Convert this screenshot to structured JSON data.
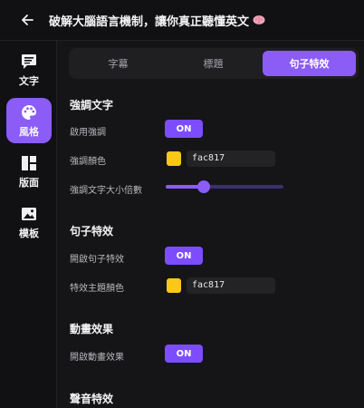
{
  "header": {
    "title": "破解大腦語言機制，讓你真正聽懂英文",
    "back_icon": "arrow-left-icon",
    "emoji_icon": "brain-icon"
  },
  "sidebar": {
    "items": [
      {
        "label": "文字",
        "icon": "text-icon",
        "active": false
      },
      {
        "label": "風格",
        "icon": "palette-icon",
        "active": true
      },
      {
        "label": "版面",
        "icon": "layout-icon",
        "active": false
      },
      {
        "label": "模板",
        "icon": "image-icon",
        "active": false
      }
    ]
  },
  "tabs": [
    {
      "label": "字幕",
      "active": false
    },
    {
      "label": "標題",
      "active": false
    },
    {
      "label": "句子特效",
      "active": true
    }
  ],
  "emphasis": {
    "section_title": "強調文字",
    "enable_label": "啟用強調",
    "enable_value": "ON",
    "color_label": "強調顏色",
    "color_hex": "fac817",
    "swatch_color": "#fac817",
    "size_label": "強調文字大小倍數",
    "size_slider_fraction": 0.32
  },
  "sentence_effect": {
    "section_title": "句子特效",
    "enable_label": "開啟句子特效",
    "enable_value": "ON",
    "color_label": "特效主題顏色",
    "color_hex": "fac817",
    "swatch_color": "#fac817"
  },
  "animation": {
    "section_title": "動畫效果",
    "enable_label": "開啟動畫效果",
    "enable_value": "ON"
  },
  "sound": {
    "section_title": "聲音特效"
  },
  "colors": {
    "accent": "#8b5cf6",
    "toggle": "#7c4dff"
  }
}
